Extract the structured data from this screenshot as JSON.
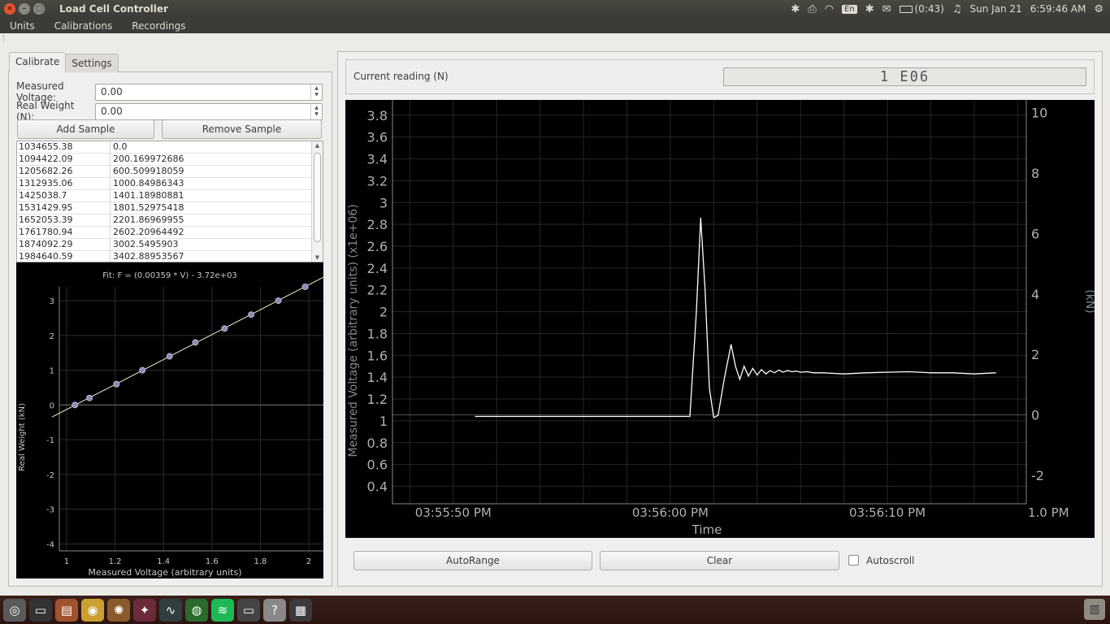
{
  "window": {
    "title": "Load Cell Controller",
    "close_glyph": "×",
    "min_glyph": "–",
    "max_glyph": "□"
  },
  "indicators": {
    "language": "En",
    "battery": "(0:43)",
    "date": "Sun Jan 21",
    "time": "6:59:46 AM"
  },
  "menubar": {
    "items": [
      "Units",
      "Calibrations",
      "Recordings"
    ]
  },
  "tabs": [
    "Calibrate",
    "Settings"
  ],
  "calibrate": {
    "measured_voltage_label": "Measured Voltage:",
    "measured_voltage_value": "0.00",
    "real_weight_label": "Real Weight (N):",
    "real_weight_value": "0.00",
    "add_sample": "Add Sample",
    "remove_sample": "Remove Sample",
    "samples": [
      [
        "1034655.38",
        "0.0"
      ],
      [
        "1094422.09",
        "200.169972686"
      ],
      [
        "1205682.26",
        "600.509918059"
      ],
      [
        "1312935.06",
        "1000.84986343"
      ],
      [
        "1425038.7",
        "1401.18980881"
      ],
      [
        "1531429.95",
        "1801.52975418"
      ],
      [
        "1652053.39",
        "2201.86969955"
      ],
      [
        "1761780.94",
        "2602.20964492"
      ],
      [
        "1874092.29",
        "3002.5495903"
      ],
      [
        "1984640.59",
        "3402.88953567"
      ]
    ]
  },
  "reading": {
    "label": "Current reading (N)",
    "lcd": "1 E06"
  },
  "controls": {
    "autorange": "AutoRange",
    "clear": "Clear",
    "autoscroll": "Autoscroll"
  },
  "chart_data": [
    {
      "type": "scatter",
      "title": "Fit: F = (0.00359 * V) - 3.72e+03",
      "xlabel": "Measured Voltage (arbitrary units)",
      "ylabel": "Real Weight (kN)",
      "xlim": [
        0.97,
        2.06
      ],
      "ylim": [
        -4.2,
        3.4
      ],
      "x_ticks": [
        1,
        1.2,
        1.4,
        1.6,
        1.8,
        2
      ],
      "y_ticks": [
        -4,
        -3,
        -2,
        -1,
        0,
        1,
        2,
        3
      ],
      "grid": true,
      "points_x": [
        1.0347,
        1.0944,
        1.2057,
        1.3129,
        1.425,
        1.5314,
        1.6521,
        1.7618,
        1.8741,
        1.9846
      ],
      "points_y": [
        0.0,
        0.2,
        0.6,
        1.0,
        1.4,
        1.8,
        2.2,
        2.6,
        3.0,
        3.4
      ],
      "fit": {
        "slope": 3.59,
        "intercept": -3.72
      }
    },
    {
      "type": "line",
      "xlabel": "Time",
      "ylabel": "Measured Voltage (arbitrary units) (x1e+06)",
      "y2label": "(kN)",
      "ylim": [
        0.24,
        3.94
      ],
      "y2lim": [
        -2.94,
        10.42
      ],
      "y_ticks": [
        0.4,
        0.6,
        0.8,
        1,
        1.2,
        1.4,
        1.6,
        1.8,
        2,
        2.2,
        2.4,
        2.6,
        2.8,
        3,
        3.2,
        3.4,
        3.6,
        3.8
      ],
      "y2_ticks": [
        -2,
        0,
        2,
        4,
        6,
        8,
        10
      ],
      "x_ticks": [
        "03:55:50 PM",
        "03:56:00 PM",
        "03:56:10 PM"
      ],
      "x_tick_partial": "1.0 PM",
      "xlim_seconds": [
        -12.8,
        16.4
      ],
      "grid": true,
      "x": [
        -9,
        -3,
        0,
        0.9,
        1.2,
        1.4,
        1.6,
        1.8,
        2.0,
        2.2,
        2.5,
        2.8,
        3.0,
        3.2,
        3.4,
        3.6,
        3.8,
        4.0,
        4.2,
        4.4,
        4.6,
        4.8,
        5.0,
        5.2,
        5.4,
        5.6,
        5.8,
        6.0,
        6.3,
        6.6,
        7,
        8,
        9,
        10,
        11,
        12,
        13,
        14,
        15
      ],
      "y": [
        1.04,
        1.04,
        1.04,
        1.04,
        2.0,
        2.86,
        2.2,
        1.3,
        1.03,
        1.05,
        1.4,
        1.7,
        1.5,
        1.38,
        1.5,
        1.41,
        1.48,
        1.42,
        1.47,
        1.43,
        1.46,
        1.44,
        1.465,
        1.445,
        1.46,
        1.45,
        1.455,
        1.445,
        1.45,
        1.44,
        1.44,
        1.43,
        1.44,
        1.445,
        1.45,
        1.44,
        1.44,
        1.43,
        1.44
      ]
    }
  ]
}
